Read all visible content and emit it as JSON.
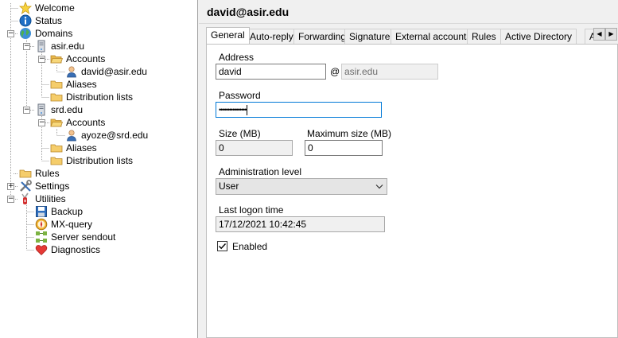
{
  "tree": {
    "items": [
      {
        "label": "Welcome",
        "icon": "star-icon"
      },
      {
        "label": "Status",
        "icon": "info-icon"
      },
      {
        "label": "Domains",
        "icon": "globe-icon"
      },
      {
        "label": "asir.edu",
        "icon": "server-icon"
      },
      {
        "label": "Accounts",
        "icon": "folder-icon"
      },
      {
        "label": "david@asir.edu",
        "icon": "user-icon"
      },
      {
        "label": "Aliases",
        "icon": "folder-icon"
      },
      {
        "label": "Distribution lists",
        "icon": "folder-icon"
      },
      {
        "label": "srd.edu",
        "icon": "server-icon"
      },
      {
        "label": "Accounts",
        "icon": "folder-icon"
      },
      {
        "label": "ayoze@srd.edu",
        "icon": "user-icon"
      },
      {
        "label": "Aliases",
        "icon": "folder-icon"
      },
      {
        "label": "Distribution lists",
        "icon": "folder-icon"
      },
      {
        "label": "Rules",
        "icon": "folder-icon"
      },
      {
        "label": "Settings",
        "icon": "tools-icon"
      },
      {
        "label": "Utilities",
        "icon": "swiss-knife-icon"
      },
      {
        "label": "Backup",
        "icon": "floppy-disk-icon"
      },
      {
        "label": "MX-query",
        "icon": "compass-icon"
      },
      {
        "label": "Server sendout",
        "icon": "network-icon"
      },
      {
        "label": "Diagnostics",
        "icon": "heart-icon"
      }
    ]
  },
  "header": {
    "title": "david@asir.edu"
  },
  "tabs": [
    {
      "label": "General"
    },
    {
      "label": "Auto-reply"
    },
    {
      "label": "Forwarding"
    },
    {
      "label": "Signature"
    },
    {
      "label": "External accounts"
    },
    {
      "label": "Rules"
    },
    {
      "label": "Active Directory"
    },
    {
      "label": "Adva"
    }
  ],
  "tab_scroll": {
    "left": "◀",
    "right": "▶"
  },
  "form": {
    "address_label": "Address",
    "address_value": "david",
    "at_sign": "@",
    "domain_value": "asir.edu",
    "password_label": "Password",
    "password_value": "••••••••••••••••",
    "size_label": "Size (MB)",
    "size_value": "0",
    "max_size_label": "Maximum size (MB)",
    "max_size_value": "0",
    "admin_level_label": "Administration level",
    "admin_level_value": "User",
    "last_logon_label": "Last logon time",
    "last_logon_value": "17/12/2021 10:42:45",
    "enabled_label": "Enabled",
    "enabled_checked": true
  },
  "colors": {
    "accent": "#0078d7",
    "folder": "#f5cd6b",
    "selection_border": "#0078d7"
  }
}
